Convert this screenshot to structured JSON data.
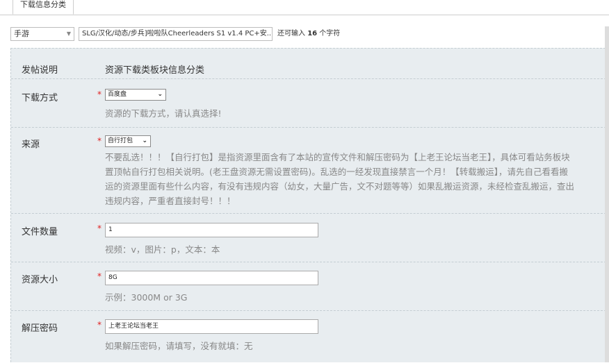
{
  "tab": {
    "label": "下载信息分类"
  },
  "title_row": {
    "type_value": "手游",
    "title_value": "SLG/汉化/动态/步兵]啦啦队Cheerleaders S1 v1.4 PC+安...",
    "remain_prefix": "还可输入",
    "remain_count": "16",
    "remain_suffix": "个字符"
  },
  "form": {
    "post_desc": {
      "label": "发帖说明",
      "value": "资源下载类板块信息分类"
    },
    "download_method": {
      "label": "下载方式",
      "required": "*",
      "selected": "百度盘",
      "hint": "资源的下载方式，请认真选择!"
    },
    "source": {
      "label": "来源",
      "required": "*",
      "selected": "自行打包",
      "hint_lines": [
        "不要乱选！！！【自行打包】是指资源里面含有了本站的宣传文件和解压密码为【上老王论坛当老王】，具体可看站务板块",
        "置顶帖自行打包相关说明。(老王盘资源无需设置密码)。乱选的一经发现直接禁言一个月！【转载搬运】，请先自己看看搬",
        "运的资源里面有些什么内容，有没有违规内容（幼女，大量广告，文不对题等等）如果乱搬运资源，未经检查乱搬运，查出",
        "违规内容，严重者直接封号！！！"
      ]
    },
    "file_count": {
      "label": "文件数量",
      "required": "*",
      "value": "1",
      "hint": "视频：v，图片：p，文本：本"
    },
    "resource_size": {
      "label": "资源大小",
      "required": "*",
      "value": "8G",
      "hint": "示例：3000M or 3G"
    },
    "unzip_password": {
      "label": "解压密码",
      "required": "*",
      "value": "上老王论坛当老王",
      "hint": "如果解压密码，请填写，没有就填：无"
    }
  }
}
